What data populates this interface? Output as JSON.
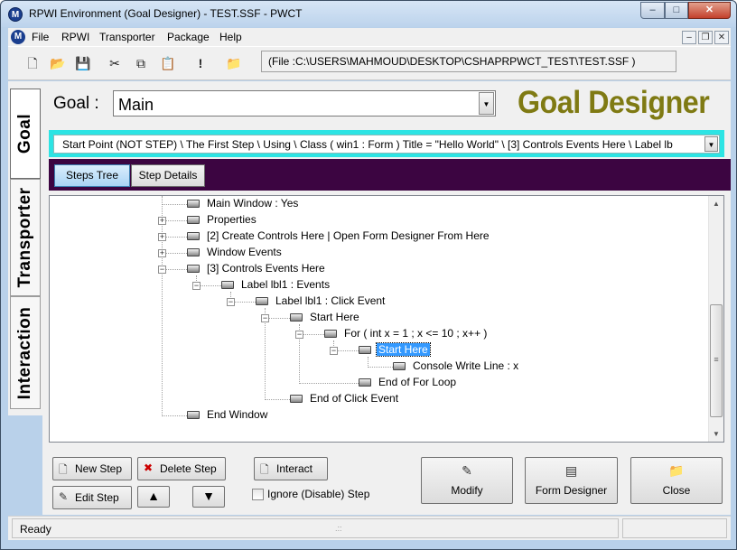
{
  "window": {
    "title": "RPWI Environment (Goal Designer) - TEST.SSF  - PWCT",
    "app_icon": "M",
    "minimize": "–",
    "maximize": "□",
    "close": "✕"
  },
  "menubar": {
    "items": [
      "File",
      "RPWI",
      "Transporter",
      "Package",
      "Help"
    ],
    "mdi_controls": [
      "–",
      "❐",
      "✕"
    ]
  },
  "toolbar": {
    "buttons": [
      "new-icon",
      "open-icon",
      "save-icon",
      "cut-icon",
      "copy-icon",
      "paste-icon",
      "run-icon",
      "folder-up-icon"
    ],
    "file_path": "(File :C:\\USERS\\MAHMOUD\\DESKTOP\\CSHAPRPWCT_TEST\\TEST.SSF )"
  },
  "side_tabs": [
    "Goal",
    "Transporter",
    "Interaction"
  ],
  "goal": {
    "label": "Goal :",
    "value": "Main",
    "designer_title": "Goal Designer"
  },
  "path_bar": {
    "text": "Start Point (NOT STEP)  \\  The First Step  \\  Using  \\  Class ( win1 : Form )  Title = \"Hello World\"  \\  [3] Controls Events Here  \\  Label lb"
  },
  "tabs": {
    "steps_tree": "Steps Tree",
    "step_details": "Step Details"
  },
  "tree": {
    "nodes": [
      {
        "label": "Main Window : Yes"
      },
      {
        "label": "Properties",
        "expander": "+"
      },
      {
        "label": "[2] Create Controls Here |  Open Form Designer From Here",
        "expander": "+"
      },
      {
        "label": "Window Events",
        "expander": "+"
      },
      {
        "label": "[3] Controls Events Here",
        "expander": "−"
      },
      {
        "label": "Label lbl1 : Events",
        "expander": "−"
      },
      {
        "label": "Label lbl1 : Click Event",
        "expander": "−"
      },
      {
        "label": "Start Here",
        "expander": "−"
      },
      {
        "label": "For ( int x = 1 ; x <= 10 ; x++ )",
        "expander": "−"
      },
      {
        "label": "Start Here",
        "expander": "−",
        "selected": true
      },
      {
        "label": "Console Write Line : x"
      },
      {
        "label": "End of For Loop"
      },
      {
        "label": "End of Click Event"
      },
      {
        "label": "End Window"
      }
    ]
  },
  "actions": {
    "new_step": "New Step",
    "delete_step": "Delete Step",
    "interact": "Interact",
    "edit_step": "Edit Step",
    "move_up": "▲",
    "move_down": "▼",
    "ignore_step": "Ignore (Disable) Step",
    "modify": "Modify",
    "form_designer": "Form Designer",
    "close": "Close"
  },
  "status": {
    "text": "Ready",
    "grip": ".::"
  }
}
